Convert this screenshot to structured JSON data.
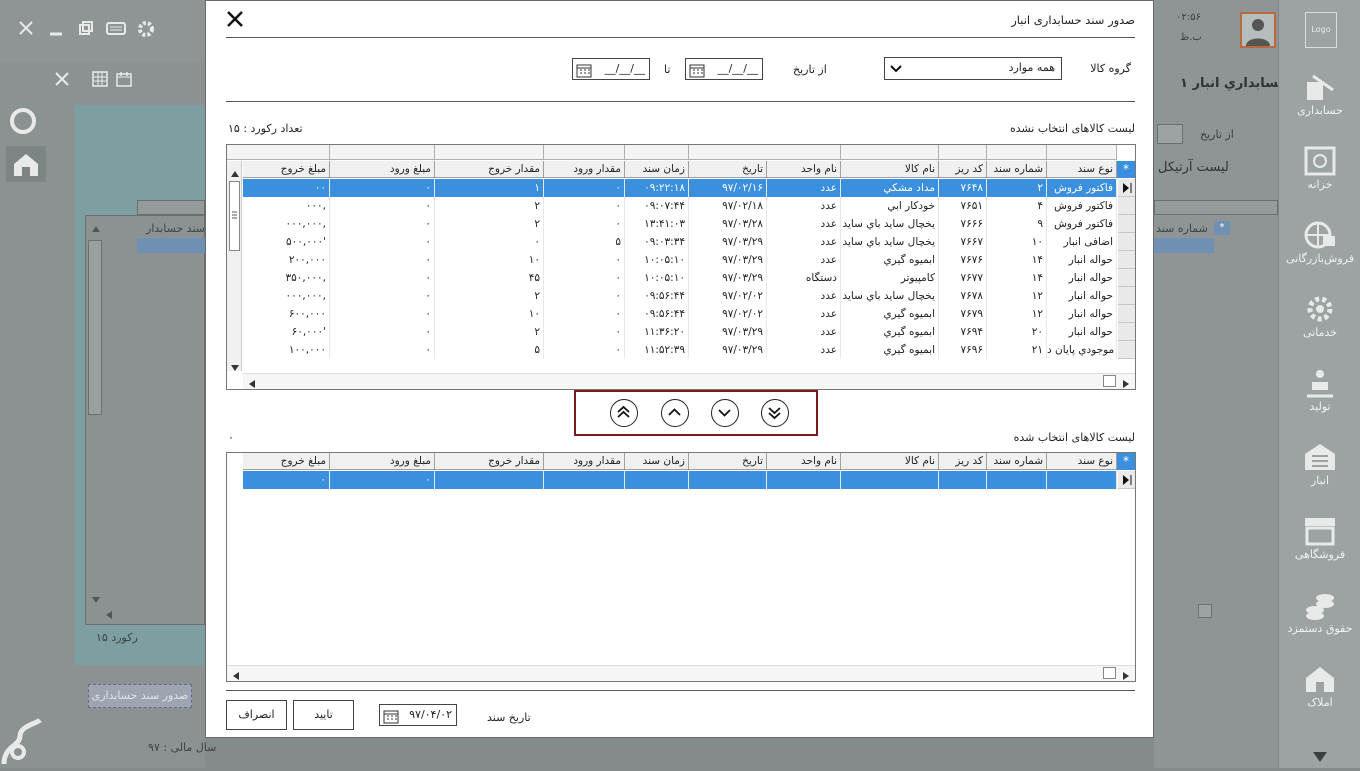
{
  "background": {
    "top_icons": [
      "close-icon",
      "minimize-icon",
      "restore-icon",
      "keyboard-icon",
      "gear-icon"
    ],
    "clock": "۰۲:۵۶",
    "clock_period": "ب.ظ",
    "logo": "Logo",
    "page_title": "حسابداري انبار ۱",
    "from_date_label": "از تاریخ",
    "list_title": "لیست آرتیکل",
    "col_doc_no": "شماره سند",
    "col_acc_doc": "سند حسابدار",
    "record_count": "۱۵ رکورد",
    "issue_btn": "صدور سند حسابداری",
    "fiscal_year": "سال مالی : ۹۷",
    "sidebar": [
      {
        "label": "حسابداری",
        "icon": "accounting-icon"
      },
      {
        "label": "خزانه",
        "icon": "safe-icon"
      },
      {
        "label": "فروش‌بازرگانی",
        "icon": "globe-icon"
      },
      {
        "label": "خدماتی",
        "icon": "gear-icon"
      },
      {
        "label": "تولید",
        "icon": "worker-icon"
      },
      {
        "label": "انبار",
        "icon": "warehouse-icon"
      },
      {
        "label": "فروشگاهی",
        "icon": "store-icon"
      },
      {
        "label": "حقوق دستمزد",
        "icon": "coins-icon"
      },
      {
        "label": "املاک",
        "icon": "house-icon"
      }
    ]
  },
  "dialog": {
    "title": "صدور سند حسابداری انبار",
    "group_label": "گروه کالا",
    "group_value": "همه موارد",
    "from_date_label": "از تاریخ",
    "from_date_value": "__/__/__",
    "to_label": "تا",
    "to_date_value": "__/__/__",
    "unselected_title": "لیست کالاهای انتخاب نشده",
    "record_count": "تعداد رکورد : ۱۵",
    "selected_title": "لیست کالاهای انتخاب شده",
    "selected_count": "۰",
    "columns": [
      "نوع سند",
      "شماره سند",
      "کد ریز",
      "نام کالا",
      "نام واحد",
      "تاریخ",
      "زمان سند",
      "مقدار ورود",
      "مقدار خروج",
      "مبلغ ورود",
      "مبلغ خروج"
    ],
    "rows": [
      [
        "فاکتور فروش",
        "۲",
        "۷۶۴۸",
        "مداد مشكي",
        "عدد",
        "۹۷/۰۲/۱۶",
        "۰۹:۲۲:۱۸",
        "۰",
        "۱",
        "۰",
        "۰۰"
      ],
      [
        "فاکتور فروش",
        "۴",
        "۷۶۵۱",
        "خودكار ابي",
        "عدد",
        "۹۷/۰۲/۱۸",
        "۰۹:۰۷:۴۴",
        "۰",
        "۲",
        "۰",
        "۰۰۰,"
      ],
      [
        "فاکتور فروش",
        "۹",
        "۷۶۶۶",
        "يخچال ساید باي ساید",
        "عدد",
        "۹۷/۰۳/۲۸",
        "۱۳:۴۱:۰۳",
        "۰",
        "۲",
        "۰",
        "۰۰۰,۰۰۰,"
      ],
      [
        "اضافی انبار",
        "۱۰",
        "۷۶۶۷",
        "يخچال ساید باي ساید",
        "عدد",
        "۹۷/۰۳/۲۹",
        "۰۹:۰۳:۳۴",
        "۵",
        "۰",
        "۰",
        "۵۰۰,۰۰۰'"
      ],
      [
        "حواله انبار",
        "۱۴",
        "۷۶۷۶",
        "ابمیوه گیري",
        "عدد",
        "۹۷/۰۳/۲۹",
        "۱۰:۰۵:۱۰",
        "۰",
        "۱۰",
        "۰",
        "۲۰۰,۰۰۰"
      ],
      [
        "حواله انبار",
        "۱۴",
        "۷۶۷۷",
        "کامپیوتر",
        "دستگاه",
        "۹۷/۰۳/۲۹",
        "۱۰:۰۵:۱۰",
        "۰",
        "۴۵",
        "۰",
        "۳۵۰,۰۰۰,"
      ],
      [
        "حواله انبار",
        "۱۲",
        "۷۶۷۸",
        "يخچال ساید باي ساید",
        "عدد",
        "۹۷/۰۲/۰۲",
        "۰۹:۵۶:۴۴",
        "۰",
        "۲",
        "۰",
        "۰۰۰,۰۰۰,"
      ],
      [
        "حواله انبار",
        "۱۲",
        "۷۶۷۹",
        "ابمیوه گیري",
        "عدد",
        "۹۷/۰۲/۰۲",
        "۰۹:۵۶:۴۴",
        "۰",
        "۱۰",
        "۰",
        "۶۰۰,۰۰۰"
      ],
      [
        "حواله انبار",
        "۲۰",
        "۷۶۹۴",
        "ابمیوه گیري",
        "عدد",
        "۹۷/۰۳/۲۹",
        "۱۱:۳۶:۲۰",
        "۰",
        "۲",
        "۰",
        "۶۰,۰۰۰'"
      ],
      [
        "موجودي پایان د",
        "۲۱",
        "۷۶۹۶",
        "ابمیوه گیري",
        "عدد",
        "۹۷/۰۳/۲۹",
        "۱۱:۵۲:۳۹",
        "۰",
        "۵",
        "۰",
        "۱۰۰,۰۰۰"
      ]
    ],
    "selected_row": [
      "",
      "",
      "",
      "",
      "",
      "",
      "",
      "",
      "",
      "۰",
      "۰"
    ],
    "doc_date_label": "تاریخ سند",
    "doc_date_value": "۹۷/۰۴/۰۲",
    "confirm_label": "تایید",
    "cancel_label": "انصراف"
  }
}
